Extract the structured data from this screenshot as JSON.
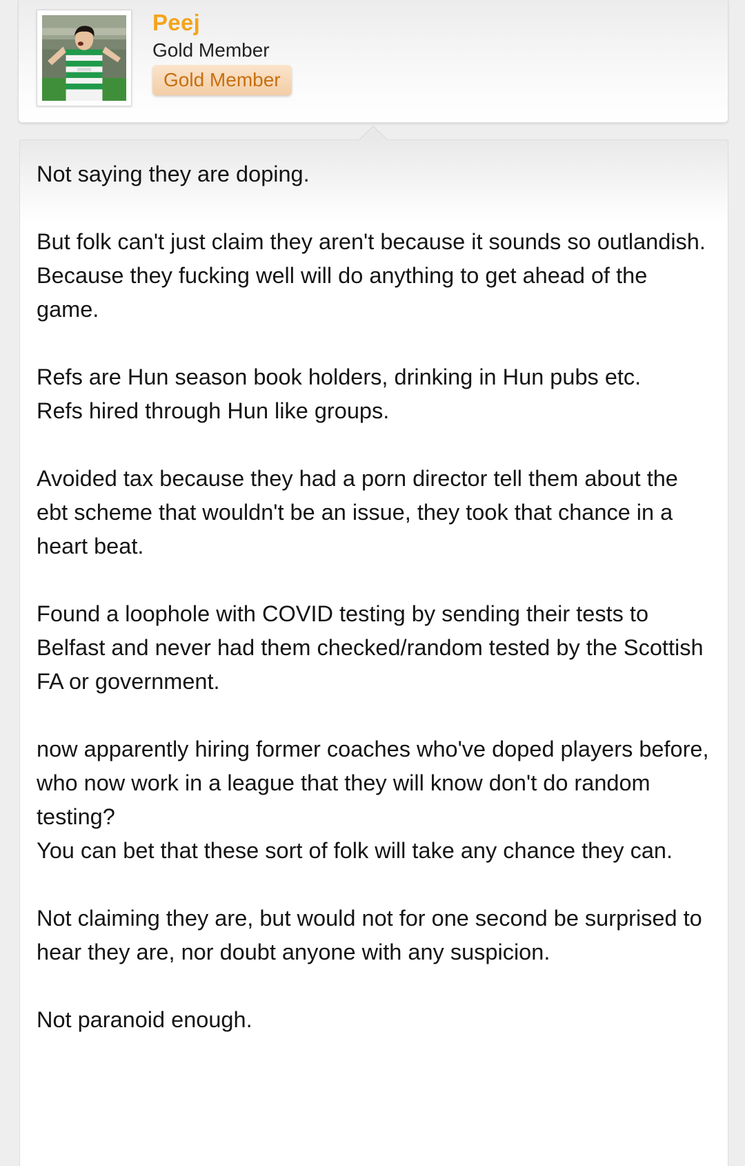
{
  "post": {
    "author": {
      "username": "Peej",
      "user_title": "Gold Member",
      "banner": "Gold Member",
      "avatar_icon": "avatar-photo-icon"
    },
    "paragraphs": [
      [
        "Not saying they are doping."
      ],
      [
        "But folk can't just claim they aren't because it sounds so outlandish.",
        "Because they fucking well will do anything to get ahead of the game."
      ],
      [
        "Refs are Hun season book holders, drinking in Hun pubs etc.",
        "Refs hired through Hun like groups."
      ],
      [
        "Avoided tax because they had a porn director tell them about the ebt scheme that wouldn't be an issue, they took that chance in a heart beat."
      ],
      [
        "Found a loophole with COVID testing by sending their tests to Belfast and never had them checked/random tested by the Scottish FA or government."
      ],
      [
        "now apparently hiring former coaches who've doped players before, who now work in a league that they will know don't do random testing?",
        "You can bet that these sort of folk will take any chance they can."
      ],
      [
        "Not claiming they are, but would not for one second be surprised to hear they are, nor doubt anyone with any suspicion."
      ],
      [
        "Not paranoid enough."
      ]
    ]
  },
  "colors": {
    "username": "#f4a41c",
    "banner_text": "#c76f10",
    "banner_bg": "#f3cda6",
    "body_text": "#141414"
  }
}
